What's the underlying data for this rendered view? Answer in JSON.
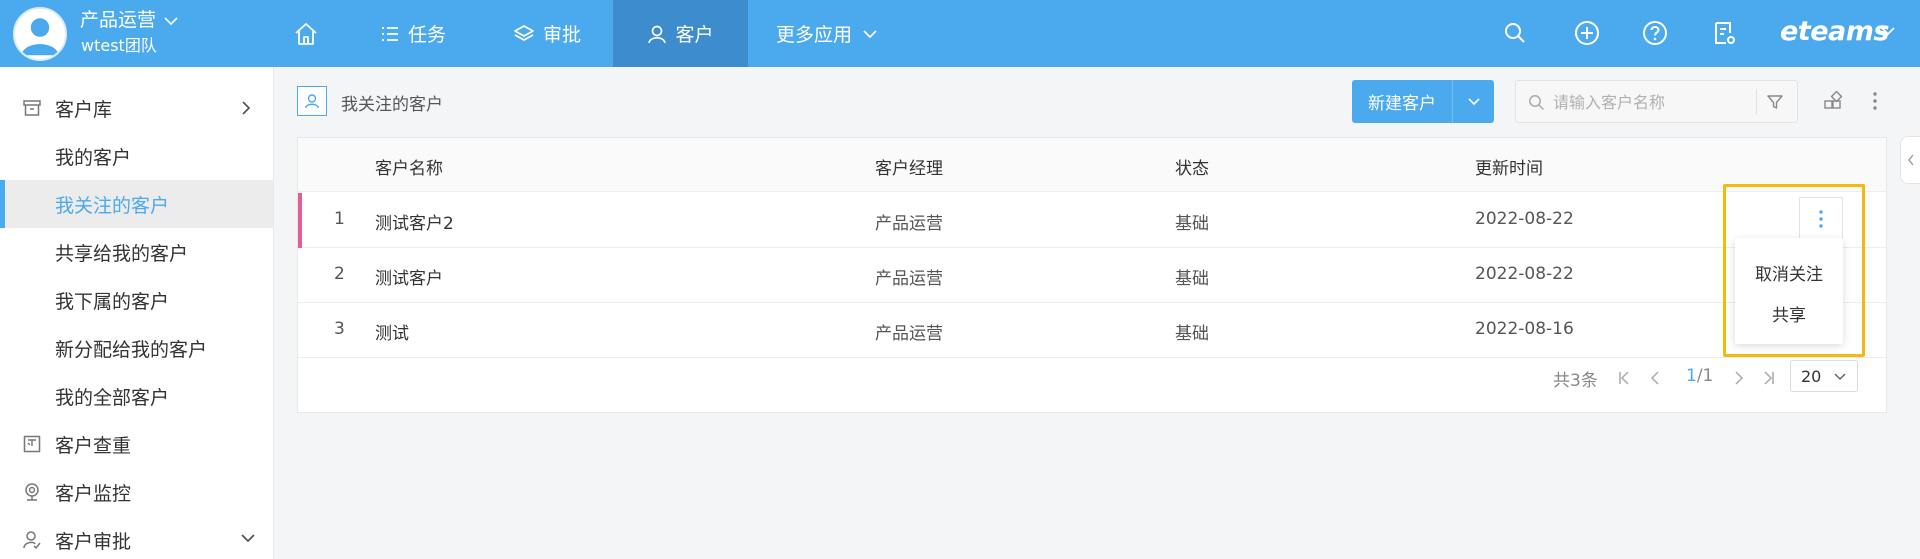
{
  "header": {
    "team_name": "产品运营",
    "team_sub": "wtest团队",
    "nav": [
      {
        "label": "",
        "icon": "home-icon"
      },
      {
        "label": "任务",
        "icon": "list-icon"
      },
      {
        "label": "审批",
        "icon": "layers-icon"
      },
      {
        "label": "客户",
        "icon": "user-icon",
        "active": true
      },
      {
        "label": "更多应用",
        "icon": "chevron-down-icon"
      }
    ],
    "brand": "eteams",
    "accent": "#4ba9ee"
  },
  "sidebar": {
    "items": [
      {
        "label": "客户库",
        "icon": "archive-icon"
      },
      {
        "label": "我的客户"
      },
      {
        "label": "我关注的客户",
        "active": true
      },
      {
        "label": "共享给我的客户"
      },
      {
        "label": "我下属的客户"
      },
      {
        "label": "新分配给我的客户"
      },
      {
        "label": "我的全部客户"
      },
      {
        "label": "客户查重",
        "icon": "duplicate-check-icon"
      },
      {
        "label": "客户监控",
        "icon": "camera-icon"
      },
      {
        "label": "客户审批",
        "icon": "approval-icon"
      }
    ]
  },
  "page": {
    "title": "我关注的客户",
    "new_button": "新建客户",
    "search_placeholder": "请输入客户名称"
  },
  "table": {
    "columns": [
      "客户名称",
      "客户经理",
      "状态",
      "更新时间"
    ],
    "rows": [
      {
        "index": "1",
        "name": "测试客户2",
        "manager": "产品运营",
        "status": "基础",
        "updated": "2022-08-22"
      },
      {
        "index": "2",
        "name": "测试客户",
        "manager": "产品运营",
        "status": "基础",
        "updated": "2022-08-22"
      },
      {
        "index": "3",
        "name": "测试",
        "manager": "产品运营",
        "status": "基础",
        "updated": "2022-08-16"
      }
    ],
    "row_marker_color": "#ea5b8e"
  },
  "pagination": {
    "total": "共3条",
    "current": "1",
    "pages": "/1",
    "page_size": "20"
  },
  "row_menu": {
    "items": [
      "取消关注",
      "共享"
    ]
  }
}
